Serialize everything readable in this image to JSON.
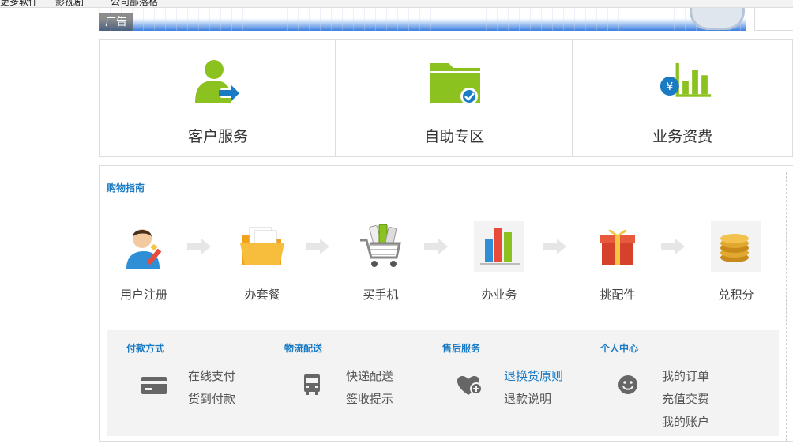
{
  "bookmarks": [
    "更多软件",
    "影视剧",
    "公司部落格"
  ],
  "ad": {
    "label": "广告"
  },
  "services": [
    {
      "label": "客户服务",
      "icon": "customer-service-icon"
    },
    {
      "label": "自助专区",
      "icon": "self-service-folder-icon"
    },
    {
      "label": "业务资费",
      "icon": "tariff-chart-icon"
    }
  ],
  "guide": {
    "title": "购物指南",
    "steps": [
      {
        "label": "用户注册",
        "icon": "user-register-icon"
      },
      {
        "label": "办套餐",
        "icon": "package-folder-icon"
      },
      {
        "label": "买手机",
        "icon": "shopping-cart-icon"
      },
      {
        "label": "办业务",
        "icon": "bar-chart-icon"
      },
      {
        "label": "挑配件",
        "icon": "gift-box-icon"
      },
      {
        "label": "兑积分",
        "icon": "coins-icon"
      }
    ],
    "columns": [
      {
        "title": "付款方式",
        "icon": "credit-card-icon",
        "links": [
          "在线支付",
          "货到付款"
        ]
      },
      {
        "title": "物流配送",
        "icon": "truck-icon",
        "links": [
          "快递配送",
          "签收提示"
        ]
      },
      {
        "title": "售后服务",
        "icon": "heart-plus-icon",
        "links": [
          "退换货原则",
          "退款说明"
        ]
      },
      {
        "title": "个人中心",
        "icon": "smiley-icon",
        "links": [
          "我的订单",
          "充值交费",
          "我的账户"
        ]
      }
    ]
  },
  "colors": {
    "accent_green": "#8cc21f",
    "accent_blue": "#1a7bc4",
    "icon_gray": "#666666"
  }
}
